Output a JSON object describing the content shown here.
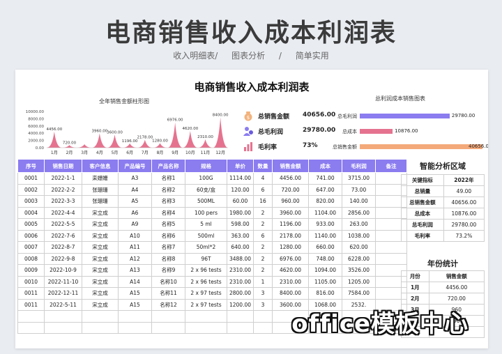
{
  "header": {
    "title": "电商销售收入成本利润表",
    "subtitle_items": [
      "收入明细表/",
      "图表分析",
      "/",
      "简单实用"
    ]
  },
  "sheet": {
    "title": "电商销售收入成本利润表",
    "left_chart_title": "全年销售金额柱形图",
    "right_chart_title": "总利润成本销售图表"
  },
  "kpis": [
    {
      "label": "总销售金额",
      "value": "40656.00",
      "icon": "money-bag-icon"
    },
    {
      "label": "总毛利润",
      "value": "29780.00",
      "icon": "people-icon"
    },
    {
      "label": "毛利率",
      "value": "73%",
      "icon": "chart-icon"
    }
  ],
  "colors": {
    "accent": "#8b7cf0",
    "pink": "#e5738f",
    "orange": "#f4a97a"
  },
  "chart_data": [
    {
      "type": "area",
      "title": "全年销售金额柱形图",
      "categories": [
        "1月",
        "2月",
        "3月",
        "4月",
        "5月",
        "6月",
        "7月",
        "8月",
        "9月",
        "10月",
        "11月",
        "12月"
      ],
      "values": [
        4456,
        720,
        960,
        3960,
        3600,
        1196,
        2178,
        1280,
        6976,
        4620,
        2310,
        8400
      ],
      "value_labels": [
        "4456.00",
        "720.00",
        "",
        "3960.00",
        "3600.00",
        "1196.00",
        "2178.00",
        "1280.00",
        "6976.00",
        "4620.00",
        "2310.00",
        "8400.00"
      ],
      "yticks": [
        "10000.00",
        "8000.00",
        "6000.00",
        "4000.00",
        "2000.00",
        "0.00"
      ],
      "ylim": [
        0,
        10000
      ]
    },
    {
      "type": "bar",
      "title": "总利润成本销售图表",
      "categories": [
        "总毛利润",
        "总成本",
        "总销售金额"
      ],
      "values": [
        29780,
        10876,
        40656
      ],
      "value_labels": [
        "29780.00",
        "10876.00",
        "40656.00"
      ],
      "colors": [
        "#8b7cf0",
        "#e5738f",
        "#f4a97a"
      ]
    }
  ],
  "table": {
    "headers": [
      "序号",
      "销售日期",
      "客户信息",
      "产品编号",
      "产品名称",
      "规格",
      "单价",
      "数量",
      "销售金额",
      "成本",
      "毛利润",
      "备注"
    ],
    "rows": [
      [
        "0001",
        "2022-1-1",
        "栾姗姗",
        "A3",
        "名称1",
        "100G",
        "1114.00",
        "4",
        "4456.00",
        "741.00",
        "3715.00",
        ""
      ],
      [
        "0002",
        "2022-2-2",
        "张珊珊",
        "A4",
        "名称2",
        "60支/盒",
        "120.00",
        "6",
        "720.00",
        "647.00",
        "73.00",
        ""
      ],
      [
        "0003",
        "2022-3-3",
        "张珊珊",
        "A5",
        "名称3",
        "500ML",
        "60.00",
        "16",
        "960.00",
        "820.00",
        "140.00",
        ""
      ],
      [
        "0004",
        "2022-4-4",
        "宋立成",
        "A6",
        "名称4",
        "100 pers",
        "1980.00",
        "2",
        "3960.00",
        "1104.00",
        "2856.00",
        ""
      ],
      [
        "0005",
        "2022-5-5",
        "宋立成",
        "A9",
        "名称5",
        "5 ml",
        "598.00",
        "2",
        "1196.00",
        "933.00",
        "263.00",
        ""
      ],
      [
        "0006",
        "2022-7-6",
        "宋立成",
        "A10",
        "名称6",
        "500ml",
        "363.00",
        "6",
        "2178.00",
        "1140.00",
        "1038.00",
        ""
      ],
      [
        "0007",
        "2022-8-7",
        "宋立成",
        "A11",
        "名称7",
        "50ml*2",
        "640.00",
        "2",
        "1280.00",
        "660.00",
        "620.00",
        ""
      ],
      [
        "0008",
        "2022-9-8",
        "宋立成",
        "A12",
        "名称8",
        "96T",
        "3488.00",
        "2",
        "6976.00",
        "748.00",
        "6228.00",
        ""
      ],
      [
        "0009",
        "2022-10-9",
        "宋立成",
        "A13",
        "名称9",
        "2 x 96 tests",
        "2310.00",
        "2",
        "4620.00",
        "1094.00",
        "3526.00",
        ""
      ],
      [
        "0010",
        "2022-11-10",
        "宋立成",
        "A14",
        "名称10",
        "2 x 96 tests",
        "2310.00",
        "1",
        "2310.00",
        "1105.00",
        "1205.00",
        ""
      ],
      [
        "0011",
        "2022-12-11",
        "宋立成",
        "A15",
        "名称11",
        "2 x 97 tests",
        "2800.00",
        "3",
        "8400.00",
        "816.00",
        "7584.00",
        ""
      ],
      [
        "0011",
        "2022-5-11",
        "宋立成",
        "A15",
        "名称12",
        "2 x 97 tests",
        "1200.00",
        "3",
        "3600.00",
        "1068.00",
        "2532.",
        ""
      ]
    ]
  },
  "analysis": {
    "title": "智能分析区域",
    "rows": [
      [
        "关键指标",
        "2022年"
      ],
      [
        "总销量",
        "49.00"
      ],
      [
        "总销售金额",
        "40656.00"
      ],
      [
        "总成本",
        "10876.00"
      ],
      [
        "总毛利润",
        "29780.00"
      ],
      [
        "毛利率",
        "73.2%"
      ]
    ]
  },
  "yearly": {
    "title": "年份统计",
    "rows": [
      [
        "月份",
        "销售金额"
      ],
      [
        "1月",
        "4456.00"
      ],
      [
        "2月",
        "720.00"
      ],
      [
        "3月",
        "960"
      ],
      [
        "4月",
        "3960"
      ],
      [
        "5月",
        "360"
      ]
    ]
  },
  "watermark": "office模板中心"
}
